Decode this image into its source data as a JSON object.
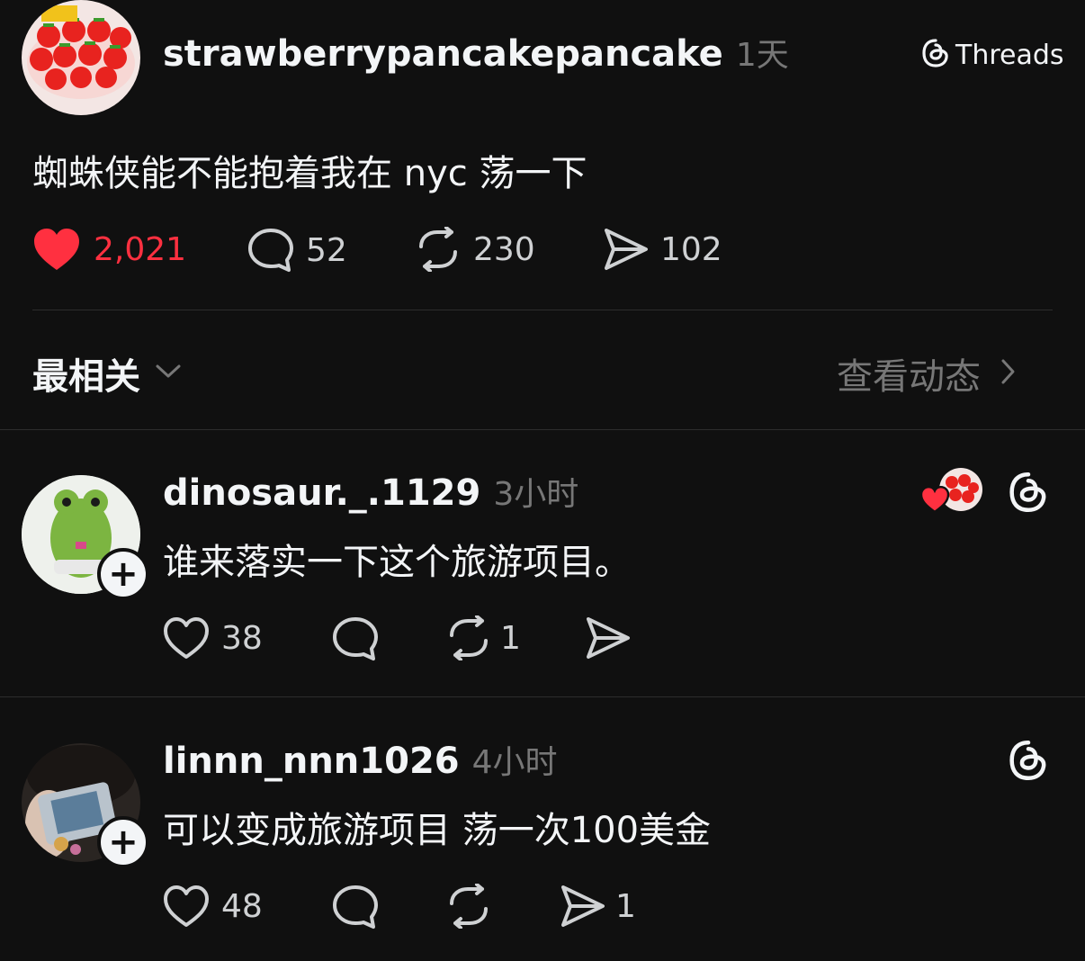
{
  "post": {
    "username": "strawberrypancakepancake",
    "time": "1天",
    "text": "蜘蛛侠能不能抱着我在 nyc 荡一下",
    "likes": "2,021",
    "comments": "52",
    "reposts": "230",
    "shares": "102",
    "brand": "Threads"
  },
  "sort": {
    "label": "最相关",
    "activity_link": "查看动态"
  },
  "replies": [
    {
      "username": "dinosaur._.1129",
      "time": "3小时",
      "text": "谁来落实一下这个旅游项目。",
      "likes": "38",
      "comments": "",
      "reposts": "1",
      "shares": ""
    },
    {
      "username": "linnn_nnn1026",
      "time": "4小时",
      "text": "可以变成旅游项目 荡一次100美金",
      "likes": "48",
      "comments": "",
      "reposts": "",
      "shares": "1"
    }
  ],
  "colors": {
    "background": "#101010",
    "like_active": "#ff3040",
    "muted": "#777777"
  }
}
